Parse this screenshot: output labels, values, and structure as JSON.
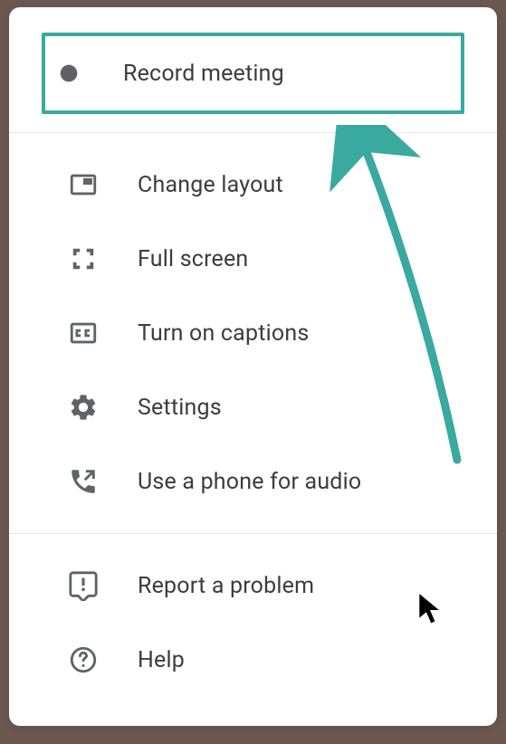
{
  "menu": {
    "colors": {
      "highlight": "#3aa9a0",
      "icon": "#5f6368",
      "text": "#3c3c3c"
    },
    "sections": [
      {
        "items": [
          {
            "id": "record-meeting",
            "icon": "record-icon",
            "label": "Record meeting",
            "highlighted": true
          }
        ]
      },
      {
        "items": [
          {
            "id": "change-layout",
            "icon": "layout-icon",
            "label": "Change layout"
          },
          {
            "id": "full-screen",
            "icon": "fullscreen-icon",
            "label": "Full screen"
          },
          {
            "id": "turn-on-captions",
            "icon": "captions-icon",
            "label": "Turn on captions"
          },
          {
            "id": "settings",
            "icon": "settings-icon",
            "label": "Settings"
          },
          {
            "id": "use-phone-audio",
            "icon": "phone-icon",
            "label": "Use a phone for audio"
          }
        ]
      },
      {
        "items": [
          {
            "id": "report-problem",
            "icon": "feedback-icon",
            "label": "Report a problem"
          },
          {
            "id": "help",
            "icon": "help-icon",
            "label": "Help"
          }
        ]
      }
    ]
  }
}
